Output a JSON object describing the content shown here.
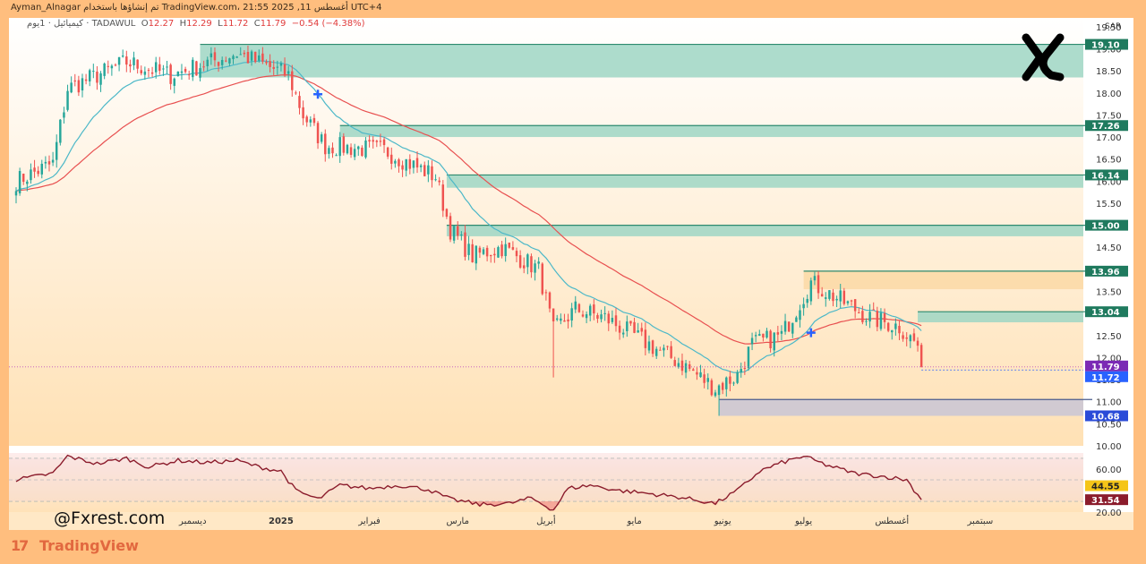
{
  "header": {
    "author_line": "Ayman_Alnagar تم إنشاؤها باستخدام TradingView.com، 21:55 2025 ,11 أغسطس UTC+4",
    "symbol": "كيميائيل · 1يوم · TADAWUL",
    "ohlc": {
      "o_label": "O",
      "o": "12.27",
      "h_label": "H",
      "h": "12.29",
      "l_label": "L",
      "l": "11.72",
      "c_label": "C",
      "c": "11.79",
      "change": "−0.54 (−4.38%)"
    }
  },
  "watermark": "@Fxrest.com",
  "footer_logo": "TradingView",
  "colors": {
    "up": "#26a69a",
    "down": "#ef5350",
    "ema_fast": "#4cb8c8",
    "ema_slow": "#e85050",
    "zone_green": "#9fd6c4",
    "zone_orange": "#fcd9a6",
    "zone_gray": "#c9c6d6",
    "rsi_line": "#8b1c2c",
    "accent": "#2962ff"
  },
  "chart_data": {
    "type": "candlestick",
    "currency": "SAR",
    "y_ticks": [
      "19.50",
      "19.00",
      "18.50",
      "18.00",
      "17.50",
      "17.00",
      "16.50",
      "16.00",
      "15.50",
      "15.00",
      "14.50",
      "14.00",
      "13.50",
      "13.00",
      "12.50",
      "12.00",
      "11.50",
      "11.00",
      "10.50",
      "10.00"
    ],
    "ylim": [
      10.0,
      19.7
    ],
    "x_labels": [
      {
        "text": "ديسمبر",
        "i": 48
      },
      {
        "text": "2025",
        "i": 72
      },
      {
        "text": "فبراير",
        "i": 96
      },
      {
        "text": "مارس",
        "i": 120
      },
      {
        "text": "أبريل",
        "i": 144
      },
      {
        "text": "مايو",
        "i": 168
      },
      {
        "text": "يونيو",
        "i": 192
      },
      {
        "text": "يوليو",
        "i": 214
      },
      {
        "text": "أغسطس",
        "i": 238
      },
      {
        "text": "سبتمبر",
        "i": 262
      }
    ],
    "price_labels": [
      {
        "value": "19.10",
        "kind": "zone"
      },
      {
        "value": "17.26",
        "kind": "zone"
      },
      {
        "value": "16.14",
        "kind": "zone"
      },
      {
        "value": "15.00",
        "kind": "zone"
      },
      {
        "value": "13.96",
        "kind": "zone"
      },
      {
        "value": "13.04",
        "kind": "zone"
      },
      {
        "value": "11.79",
        "kind": "last"
      },
      {
        "value": "11.72",
        "kind": "low"
      },
      {
        "value": "10.68",
        "kind": "zone"
      }
    ],
    "zones": [
      {
        "from_i": 50,
        "top": 19.1,
        "bottom": 18.35,
        "color": "green"
      },
      {
        "from_i": 88,
        "top": 17.26,
        "bottom": 17.0,
        "color": "green"
      },
      {
        "from_i": 117,
        "top": 16.14,
        "bottom": 15.85,
        "color": "green"
      },
      {
        "from_i": 117,
        "top": 15.0,
        "bottom": 14.75,
        "color": "green"
      },
      {
        "from_i": 214,
        "top": 13.96,
        "bottom": 13.55,
        "color": "orange"
      },
      {
        "from_i": 245,
        "top": 13.04,
        "bottom": 12.8,
        "color": "green"
      },
      {
        "from_i": 191,
        "top": 11.05,
        "bottom": 10.68,
        "color": "gray"
      }
    ],
    "key_prices": [
      {
        "t": 0,
        "p": 16.0
      },
      {
        "t": 10,
        "p": 16.4
      },
      {
        "t": 14,
        "p": 18.1
      },
      {
        "t": 30,
        "p": 18.7
      },
      {
        "t": 42,
        "p": 18.4
      },
      {
        "t": 60,
        "p": 18.9
      },
      {
        "t": 74,
        "p": 18.4
      },
      {
        "t": 78,
        "p": 17.5
      },
      {
        "t": 84,
        "p": 16.8
      },
      {
        "t": 100,
        "p": 16.7
      },
      {
        "t": 114,
        "p": 16.1
      },
      {
        "t": 118,
        "p": 14.9
      },
      {
        "t": 124,
        "p": 14.3
      },
      {
        "t": 132,
        "p": 14.5
      },
      {
        "t": 142,
        "p": 14.0
      },
      {
        "t": 146,
        "p": 12.6
      },
      {
        "t": 152,
        "p": 13.1
      },
      {
        "t": 160,
        "p": 12.9
      },
      {
        "t": 170,
        "p": 12.4
      },
      {
        "t": 182,
        "p": 11.8
      },
      {
        "t": 190,
        "p": 11.3
      },
      {
        "t": 196,
        "p": 11.6
      },
      {
        "t": 200,
        "p": 12.3
      },
      {
        "t": 208,
        "p": 12.5
      },
      {
        "t": 216,
        "p": 13.7
      },
      {
        "t": 224,
        "p": 13.3
      },
      {
        "t": 232,
        "p": 12.9
      },
      {
        "t": 240,
        "p": 12.7
      },
      {
        "t": 245,
        "p": 12.27
      },
      {
        "t": 246,
        "p": 11.79
      }
    ],
    "rsi": {
      "ticks": [
        "60.00",
        "44.55",
        "20.00"
      ],
      "levels": [
        70,
        50,
        30
      ],
      "last_labels": [
        "44.55",
        "31.54"
      ],
      "ylim": [
        20,
        75
      ],
      "points": [
        {
          "t": 0,
          "v": 50
        },
        {
          "t": 10,
          "v": 56
        },
        {
          "t": 14,
          "v": 72
        },
        {
          "t": 22,
          "v": 65
        },
        {
          "t": 30,
          "v": 70
        },
        {
          "t": 36,
          "v": 62
        },
        {
          "t": 44,
          "v": 68
        },
        {
          "t": 52,
          "v": 66
        },
        {
          "t": 60,
          "v": 68
        },
        {
          "t": 66,
          "v": 62
        },
        {
          "t": 72,
          "v": 58
        },
        {
          "t": 76,
          "v": 40
        },
        {
          "t": 82,
          "v": 32
        },
        {
          "t": 88,
          "v": 45
        },
        {
          "t": 96,
          "v": 42
        },
        {
          "t": 104,
          "v": 45
        },
        {
          "t": 112,
          "v": 41
        },
        {
          "t": 118,
          "v": 32
        },
        {
          "t": 126,
          "v": 27
        },
        {
          "t": 134,
          "v": 28
        },
        {
          "t": 140,
          "v": 33
        },
        {
          "t": 146,
          "v": 22
        },
        {
          "t": 150,
          "v": 42
        },
        {
          "t": 156,
          "v": 45
        },
        {
          "t": 164,
          "v": 40
        },
        {
          "t": 170,
          "v": 38
        },
        {
          "t": 180,
          "v": 34
        },
        {
          "t": 190,
          "v": 28
        },
        {
          "t": 196,
          "v": 40
        },
        {
          "t": 202,
          "v": 58
        },
        {
          "t": 208,
          "v": 66
        },
        {
          "t": 214,
          "v": 72
        },
        {
          "t": 220,
          "v": 64
        },
        {
          "t": 228,
          "v": 56
        },
        {
          "t": 236,
          "v": 53
        },
        {
          "t": 242,
          "v": 50
        },
        {
          "t": 246,
          "v": 31.54
        }
      ]
    }
  }
}
